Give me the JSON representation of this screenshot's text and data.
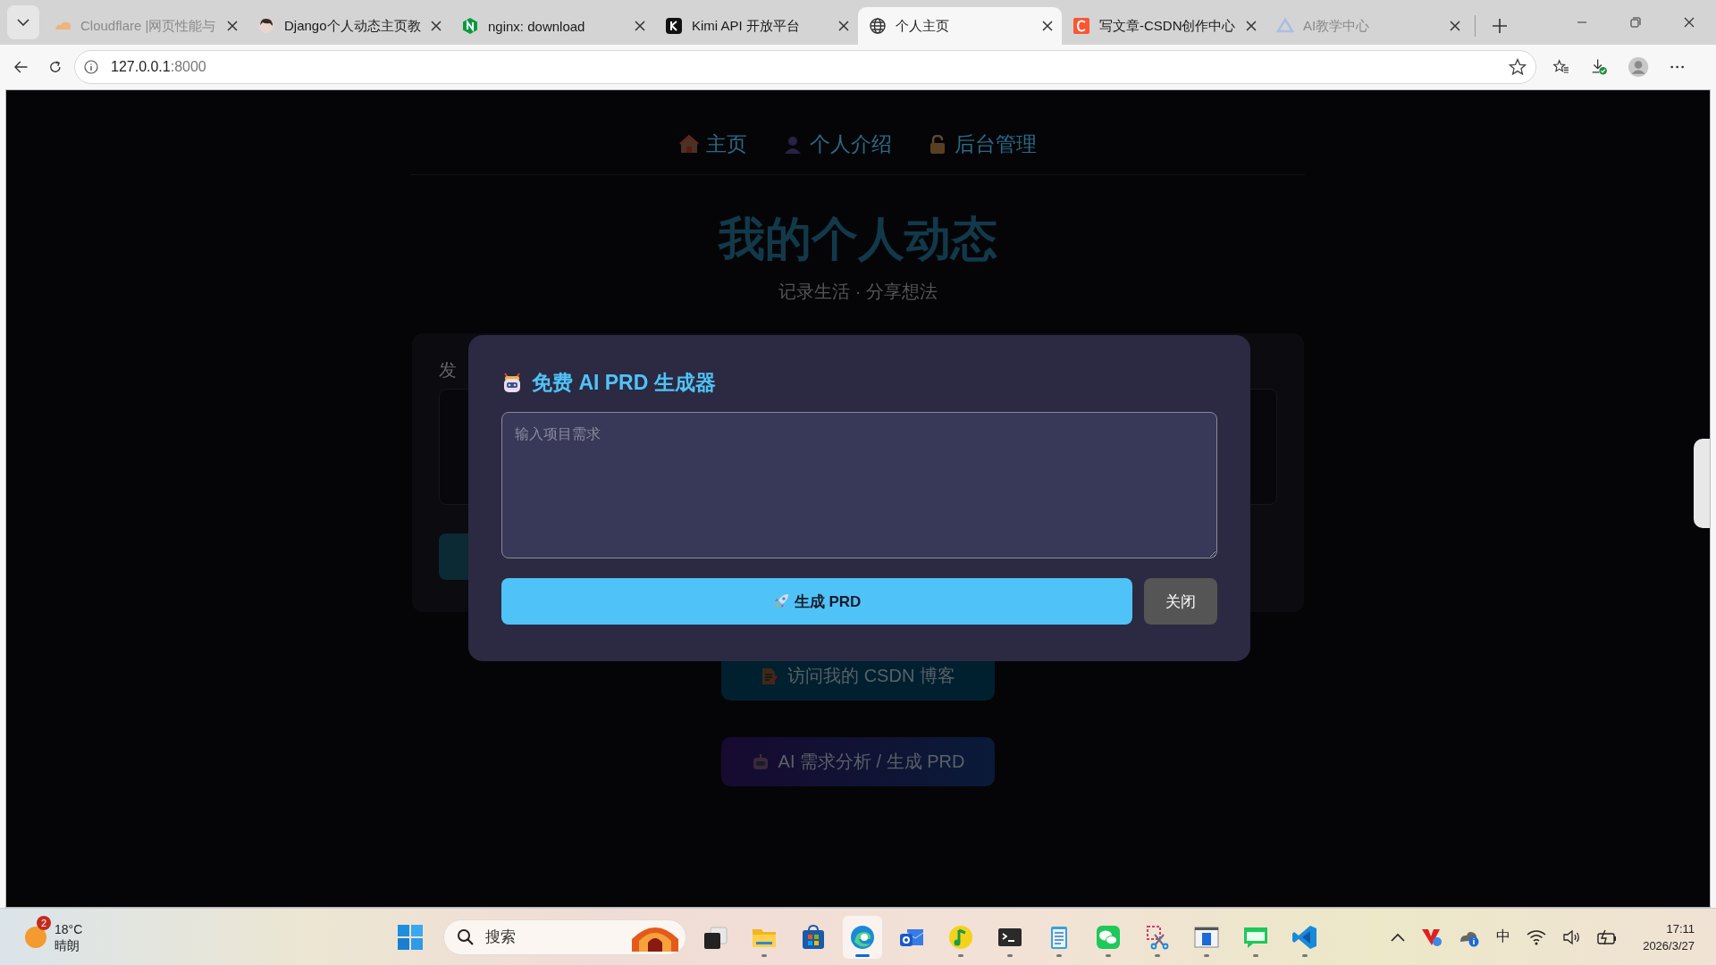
{
  "browser": {
    "tabs": [
      {
        "title": "Cloudflare |网页性能与",
        "kind": "cloud",
        "selected": false,
        "sleeping": true
      },
      {
        "title": "Django个人动态主页教",
        "kind": "avatar",
        "selected": false,
        "sleeping": false
      },
      {
        "title": "nginx: download",
        "kind": "nginx",
        "selected": false,
        "sleeping": false
      },
      {
        "title": "Kimi API 开放平台",
        "kind": "kimi",
        "selected": false,
        "sleeping": false
      },
      {
        "title": "个人主页",
        "kind": "globe",
        "selected": true,
        "sleeping": false
      },
      {
        "title": "写文章-CSDN创作中心",
        "kind": "csdn",
        "selected": false,
        "sleeping": false
      },
      {
        "title": "AI教学中心",
        "kind": "triangle",
        "selected": false,
        "sleeping": true
      }
    ],
    "address": {
      "host": "127.0.0.1",
      "port": ":8000"
    }
  },
  "page": {
    "nav": [
      {
        "label": "主页",
        "kind": "house"
      },
      {
        "label": "个人介绍",
        "kind": "person"
      },
      {
        "label": "后台管理",
        "kind": "lock"
      }
    ],
    "title": "我的个人动态",
    "subtitle": "记录生活 · 分享想法",
    "composer": {
      "label": "发"
    },
    "links": [
      {
        "label": "访问我的 CSDN 博客",
        "kind": "csdn"
      },
      {
        "label": "AI 需求分析 / 生成 PRD",
        "kind": "ai"
      }
    ],
    "modal": {
      "title": "免费 AI PRD 生成器",
      "placeholder": "输入项目需求",
      "generate_button": "生成 PRD",
      "close_button": "关闭"
    }
  },
  "taskbar": {
    "weather": {
      "badge": "2",
      "temperature": "18°C",
      "condition": "晴朗"
    },
    "search": {
      "placeholder": "搜索"
    },
    "apps": [
      {
        "kind": "taskview",
        "running": false,
        "active": false
      },
      {
        "kind": "folder",
        "running": true,
        "active": false
      },
      {
        "kind": "store",
        "running": false,
        "active": false
      },
      {
        "kind": "edge",
        "running": true,
        "active": true
      },
      {
        "kind": "mail",
        "running": false,
        "active": false
      },
      {
        "kind": "music",
        "running": true,
        "active": false
      },
      {
        "kind": "terminal",
        "running": true,
        "active": false
      },
      {
        "kind": "notepad",
        "running": true,
        "active": false
      },
      {
        "kind": "wechat",
        "running": true,
        "active": false
      },
      {
        "kind": "snip",
        "running": true,
        "active": false
      },
      {
        "kind": "window",
        "running": true,
        "active": false
      },
      {
        "kind": "chat",
        "running": true,
        "active": false
      },
      {
        "kind": "vscode",
        "running": true,
        "active": false
      }
    ],
    "ime": "中",
    "time": "17:11",
    "date": "2026/3/27"
  }
}
